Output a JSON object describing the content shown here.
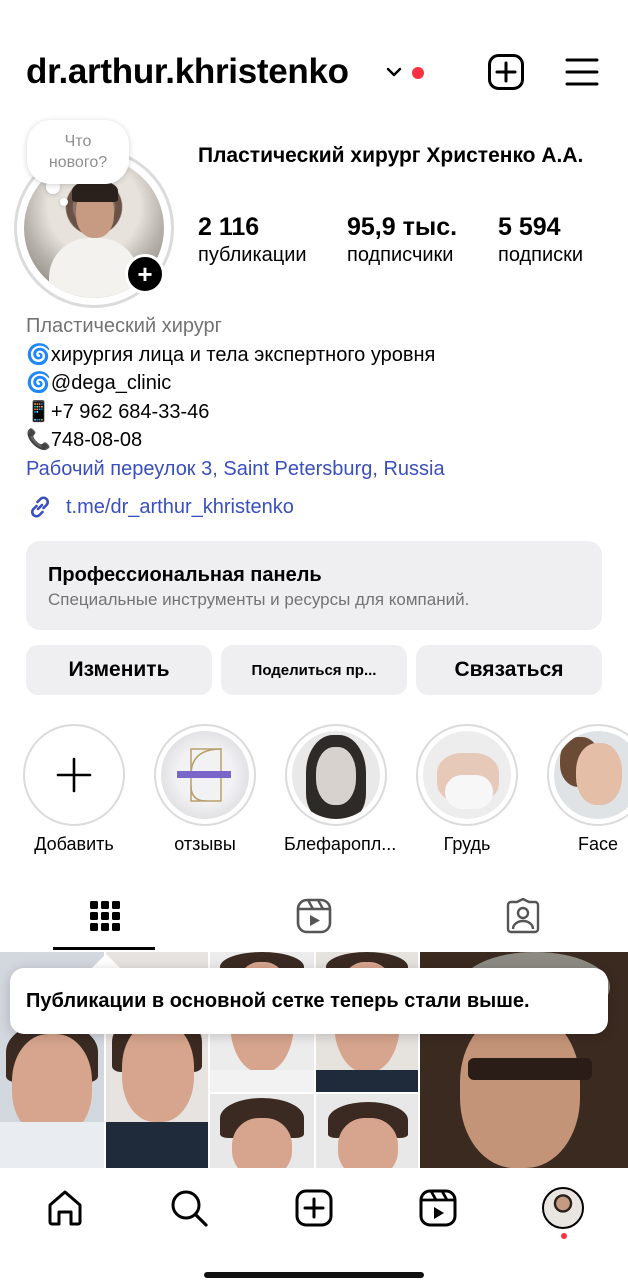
{
  "header": {
    "username": "dr.arthur.khristenko",
    "icons": [
      "chevron-down-icon",
      "notification-dot",
      "create-plus-icon",
      "hamburger-menu-icon"
    ]
  },
  "profile": {
    "note": "Что нового?",
    "full_name": "Пластический хирург Христенко А.А.",
    "stats": [
      {
        "value": "2 116",
        "label": "публикации"
      },
      {
        "value": "95,9 тыс.",
        "label": "подписчики"
      },
      {
        "value": "5 594",
        "label": "подписки"
      }
    ]
  },
  "bio": {
    "category": "Пластический хирург",
    "lines": [
      "🌀хирургия лица и тела экспертного уровня",
      "🌀@dega_clinic",
      "📱+7 962 684-33-46",
      "📞748-08-08"
    ],
    "location": "Рабочий переулок 3, Saint Petersburg, Russia",
    "link": "t.me/dr_arthur_khristenko"
  },
  "pro_panel": {
    "title": "Профессиональная панель",
    "subtitle": "Специальные инструменты и ресурсы для компаний."
  },
  "actions": {
    "edit": "Изменить",
    "share": "Поделиться пр...",
    "contact": "Связаться"
  },
  "highlights": [
    {
      "label": "Добавить"
    },
    {
      "label": "отзывы"
    },
    {
      "label": "Блефаропл..."
    },
    {
      "label": "Грудь"
    },
    {
      "label": "Face"
    }
  ],
  "tabs": [
    "grid-icon",
    "reels-icon",
    "tagged-icon"
  ],
  "tooltip": "Публикации в основной сетке теперь стали выше.",
  "bottom_nav": [
    "home-icon",
    "search-icon",
    "create-icon",
    "reels-icon",
    "profile-avatar"
  ],
  "colors": {
    "accent_link": "#3a4fbf",
    "notification": "#ff3040",
    "panel_bg": "#efeff2"
  }
}
